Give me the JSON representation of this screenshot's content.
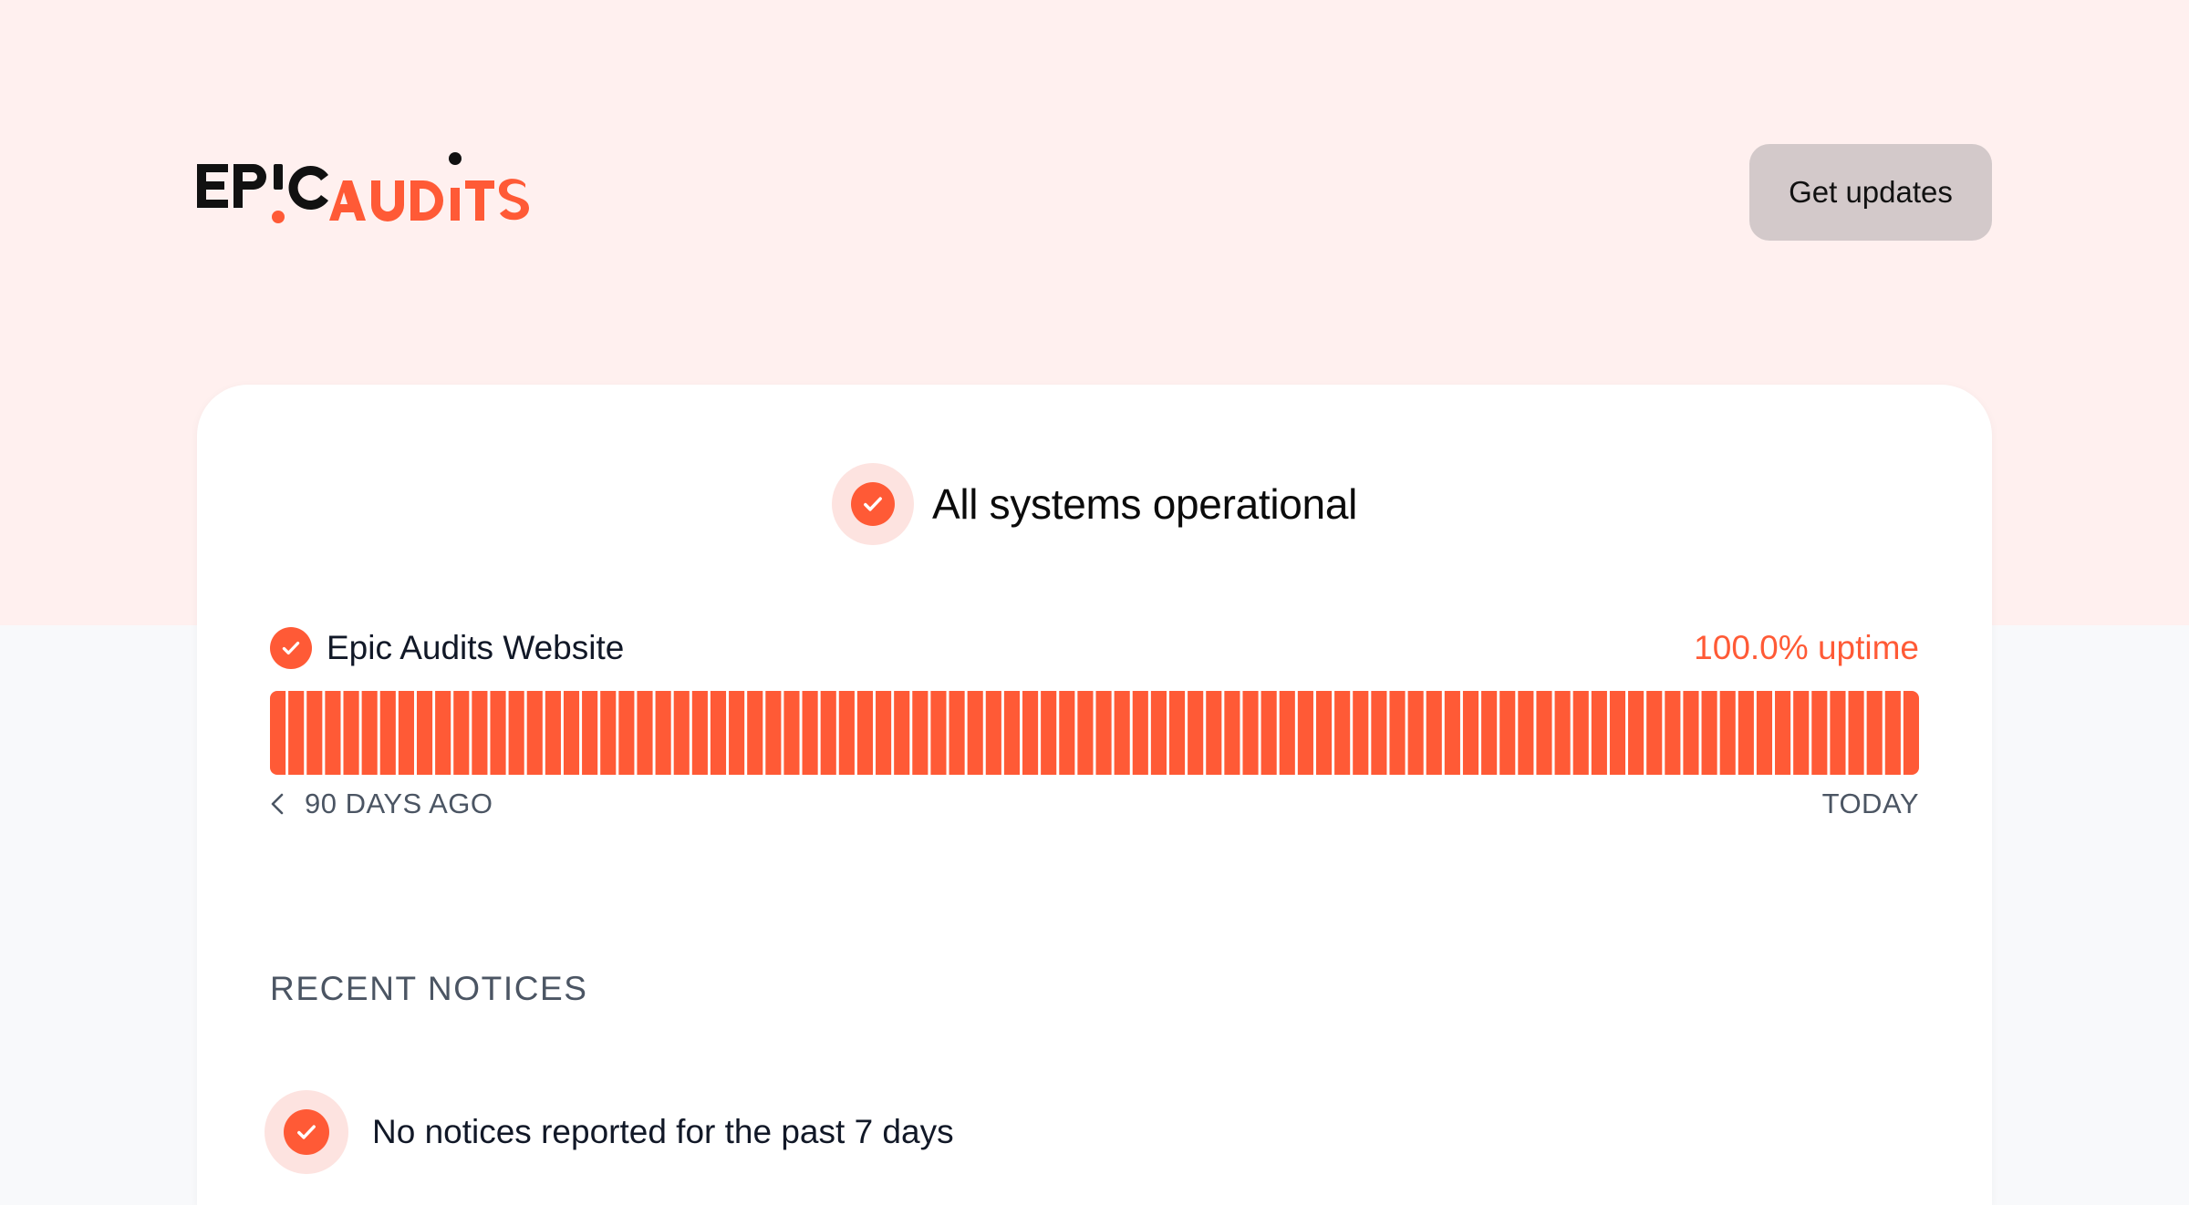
{
  "brand": {
    "logo_text_primary": "EPIC",
    "logo_text_secondary": "AUDITS",
    "colors": {
      "accent": "#ff5a36",
      "dark": "#111111",
      "band": "#fff0ef",
      "button_bg": "#d3c9ca"
    }
  },
  "header": {
    "updates_button_label": "Get updates"
  },
  "status": {
    "icon": "check-circle-icon",
    "text": "All systems operational"
  },
  "components": [
    {
      "icon": "check-circle-icon",
      "name": "Epic Audits Website",
      "uptime_label": "100.0% uptime",
      "days": 90,
      "uptime_bar_status": "operational"
    }
  ],
  "range": {
    "start_label": "90 DAYS AGO",
    "end_label": "TODAY"
  },
  "notices": {
    "heading": "RECENT NOTICES",
    "items": [
      {
        "icon": "check-circle-icon",
        "text": "No notices reported for the past 7 days"
      }
    ]
  }
}
